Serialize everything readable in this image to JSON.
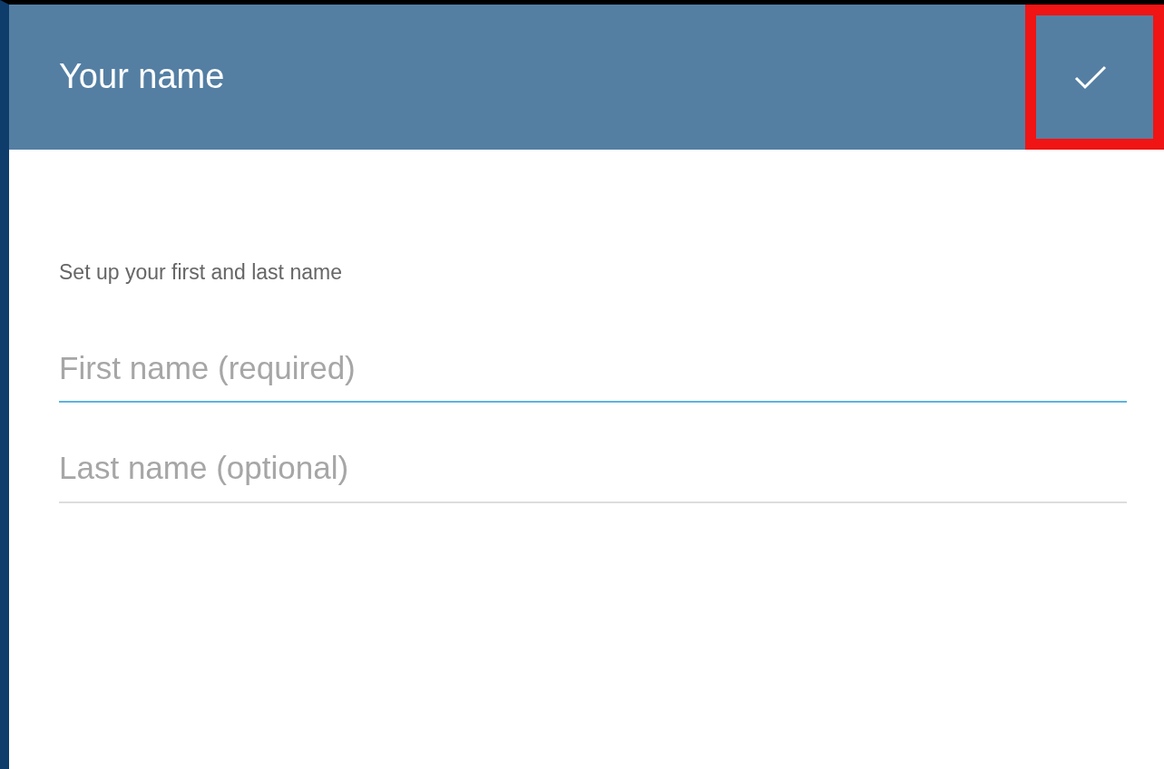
{
  "toolbar": {
    "title": "Your name",
    "confirm_highlighted": true
  },
  "description": "Set up your first and last name",
  "fields": [
    {
      "placeholder": "First name (required)",
      "focused": true
    },
    {
      "placeholder": "Last name (optional)",
      "focused": false
    }
  ]
}
